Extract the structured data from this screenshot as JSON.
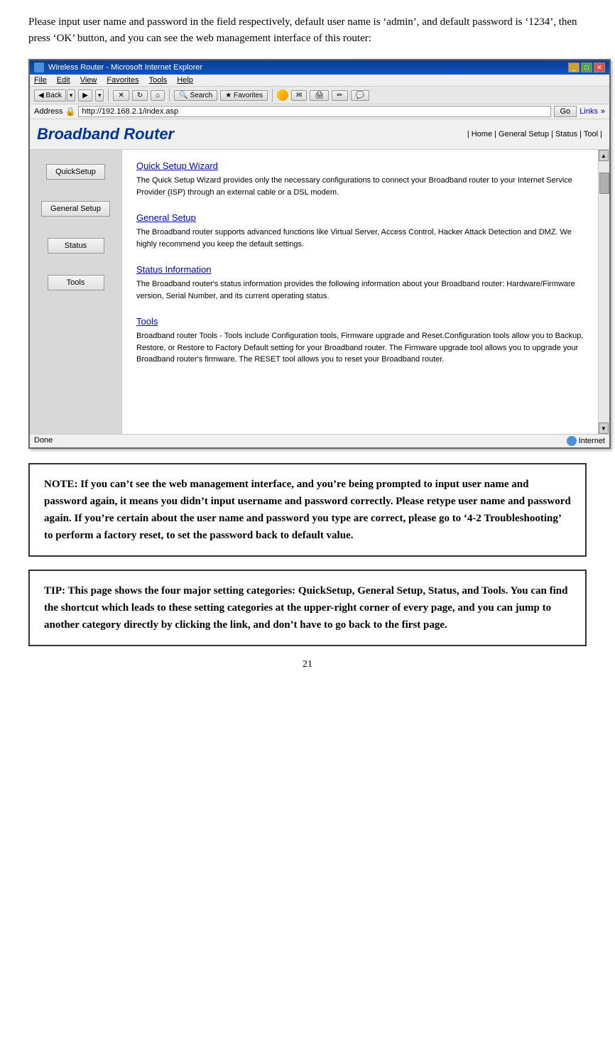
{
  "intro": {
    "text": "Please input user name and password in the field respectively, default user name is ‘admin’, and default password is ‘1234’, then press ‘OK’ button, and you can see the web management interface of this router:"
  },
  "browser": {
    "title": "Wireless Router - Microsoft Internet Explorer",
    "address": "http://192.168.2.1/index.asp",
    "status": "Done",
    "status_right": "Internet",
    "menu_items": [
      "File",
      "Edit",
      "View",
      "Favorites",
      "Tools",
      "Help"
    ],
    "toolbar_buttons": [
      "Back",
      "Forward",
      "Stop",
      "Refresh",
      "Home"
    ],
    "search_label": "Search",
    "favorites_label": "Favorites",
    "address_label": "Address",
    "go_button": "Go",
    "links_label": "Links"
  },
  "router": {
    "brand": "Broadband Router",
    "nav": "| Home | General Setup | Status | Tool |",
    "sidebar_buttons": [
      "QuickSetup",
      "General Setup",
      "Status",
      "Tools"
    ],
    "sections": [
      {
        "title": "Quick Setup Wizard",
        "text": "The Quick Setup Wizard provides only the necessary configurations to connect your Broadband router to your Internet Service Provider (ISP) through an external cable or a DSL modem."
      },
      {
        "title": "General Setup",
        "text": "The Broadband router supports advanced functions like Virtual Server, Access Control, Hacker Attack Detection and DMZ. We highly recommend you keep the default settings."
      },
      {
        "title": "Status Information",
        "text": "The Broadband router's status information provides the following information about your Broadband router: Hardware/Firmware version, Serial Number, and its current operating status."
      },
      {
        "title": "Tools",
        "text": "Broadband router Tools - Tools include Configuration tools, Firmware upgrade and Reset.Configuration tools allow you to Backup, Restore, or Restore to Factory Default setting for your Broadband router. The Firmware upgrade tool allows you to upgrade your Broadband router's firmware. The RESET tool allows you to reset your Broadband router."
      }
    ]
  },
  "note": {
    "text": "NOTE: If you can’t see the web management interface, and you’re being prompted to input user name and password again, it means you didn’t input username and password correctly. Please retype user name and password again. If you’re certain about the user name and password you type are correct, please go to ‘4-2 Troubleshooting’ to perform a factory reset, to set the password back to default value."
  },
  "tip": {
    "text": "TIP: This page shows the four major setting categories: QuickSetup, General Setup, Status, and Tools. You can find the shortcut which leads to these setting categories at the upper-right corner of every page, and you can jump to another category directly by clicking the link, and don’t have to go back to the first page."
  },
  "page_number": "21"
}
